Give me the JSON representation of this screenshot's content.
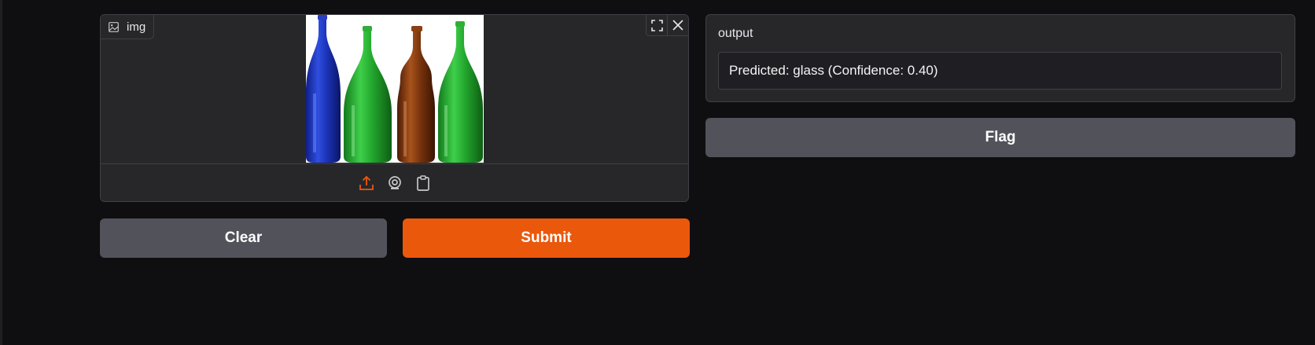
{
  "input": {
    "label": "img",
    "label_icon": "image-icon",
    "tools": [
      "fullscreen-icon",
      "close-icon"
    ],
    "sources": [
      "upload-icon",
      "webcam-icon",
      "clipboard-icon"
    ],
    "active_source_color": "#ea580c"
  },
  "buttons": {
    "clear": "Clear",
    "submit": "Submit",
    "flag": "Flag"
  },
  "output": {
    "label": "output",
    "value": "Predicted: glass (Confidence: 0.40)"
  },
  "colors": {
    "background": "#0f0f11",
    "panel": "#27272a",
    "accent": "#ea580c",
    "secondary_button": "#52525b"
  }
}
